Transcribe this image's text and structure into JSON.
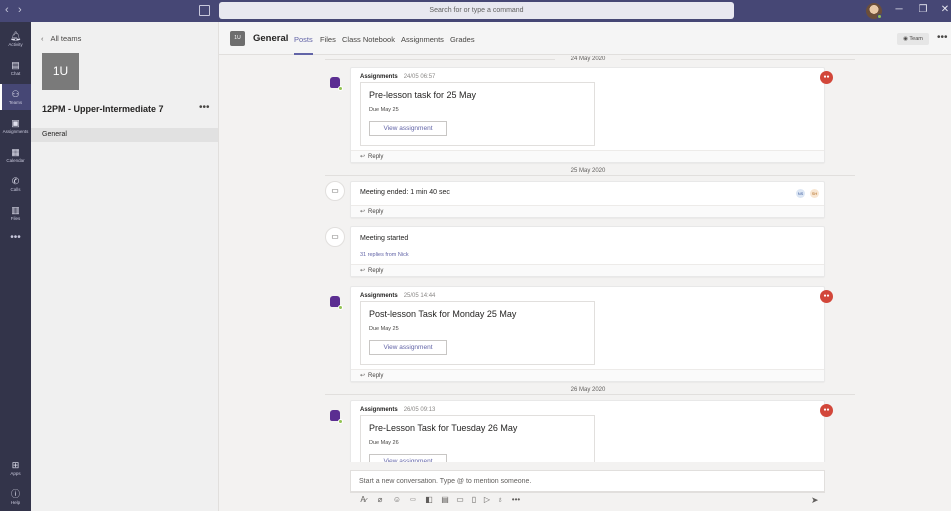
{
  "titlebar": {
    "back_icon": "‹",
    "forward_icon": "›",
    "search_placeholder": "Search for or type a command"
  },
  "rail": [
    {
      "label": "Activity",
      "icon": "bell-icon"
    },
    {
      "label": "Chat",
      "icon": "chat-icon"
    },
    {
      "label": "Teams",
      "icon": "teams-icon",
      "active": true
    },
    {
      "label": "Assignments",
      "icon": "assignments-icon"
    },
    {
      "label": "Calendar",
      "icon": "calendar-icon"
    },
    {
      "label": "Calls",
      "icon": "phone-icon"
    },
    {
      "label": "Files",
      "icon": "files-icon"
    },
    {
      "label": "Apps",
      "icon": "apps-icon"
    },
    {
      "label": "Help",
      "icon": "help-icon"
    }
  ],
  "sidebar": {
    "back_label": "All teams",
    "team_tile": "1U",
    "team_name": "12PM - Upper-Intermediate 7",
    "channels": [
      {
        "label": "General",
        "selected": true
      }
    ]
  },
  "header": {
    "avatar": "1U",
    "title": "General",
    "tabs": [
      "Posts",
      "Files",
      "Class Notebook",
      "Assignments",
      "Grades"
    ],
    "active_tab": "Posts",
    "team_button": "Team"
  },
  "feed": {
    "dates": [
      "24 May 2020",
      "25 May 2020",
      "26 May 2020"
    ],
    "posts": [
      {
        "type": "assignment",
        "author": "Assignments",
        "time": "24/05 06:57",
        "title": "Pre-lesson task for 25 May",
        "due": "Due May 25",
        "button": "View assignment",
        "reply": "Reply"
      },
      {
        "type": "meeting",
        "text": "Meeting ended: 1 min 40 sec",
        "participants": [
          "NS",
          "SH"
        ],
        "reply": "Reply"
      },
      {
        "type": "meeting",
        "text": "Meeting started",
        "replies": "31 replies from Nick",
        "reply": "Reply"
      },
      {
        "type": "assignment",
        "author": "Assignments",
        "time": "25/05 14:44",
        "title": "Post-lesson Task for Monday 25 May",
        "due": "Due May 25",
        "button": "View assignment",
        "reply": "Reply"
      },
      {
        "type": "assignment",
        "author": "Assignments",
        "time": "26/05 09:13",
        "title": "Pre-Lesson Task for Tuesday 26 May",
        "due": "Due May 26",
        "button": "View assignment"
      }
    ]
  },
  "compose": {
    "placeholder": "Start a new conversation. Type @ to mention someone."
  },
  "colors": {
    "titlebar": "#464775",
    "rail": "#33344a",
    "accent": "#6264a7",
    "assignments_app": "#5b2e91",
    "reaction": "#d2473a"
  }
}
